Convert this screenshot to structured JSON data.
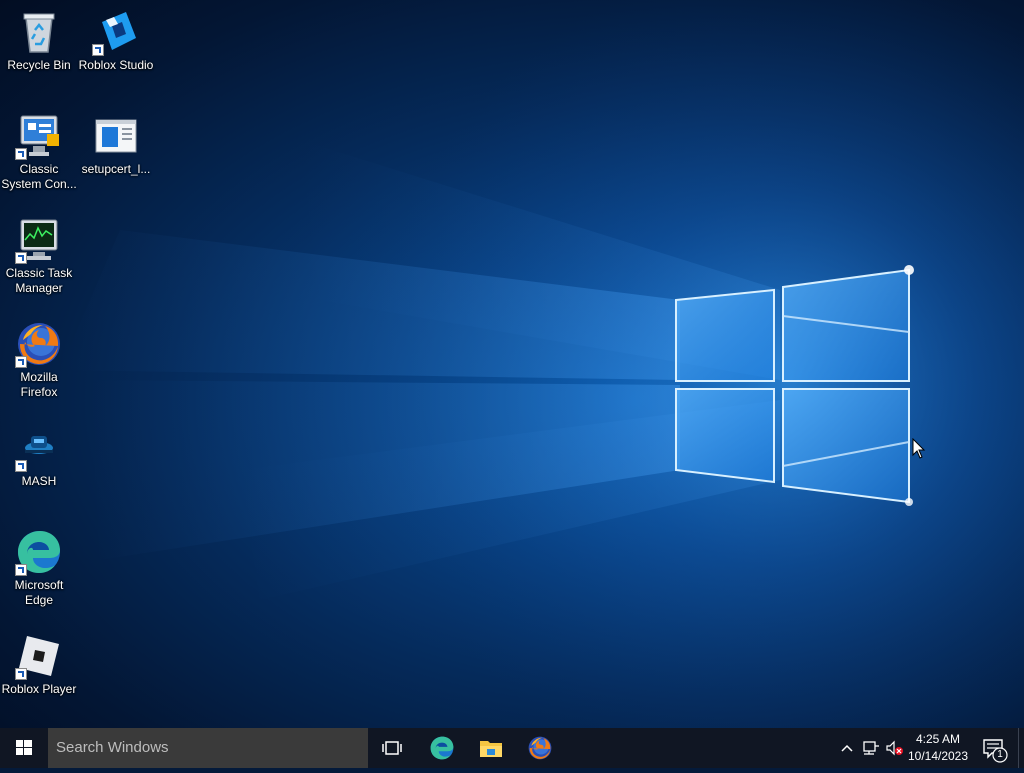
{
  "desktop": {
    "icons": [
      {
        "label": "Recycle Bin",
        "icon": "recycle-bin-icon"
      },
      {
        "label": "Roblox Studio",
        "icon": "roblox-studio-icon"
      },
      {
        "label": "Classic System Con...",
        "icon": "control-panel-icon"
      },
      {
        "label": "setupcert_l...",
        "icon": "window-file-icon"
      },
      {
        "label": "Classic Task Manager",
        "icon": "task-manager-icon"
      },
      {
        "label": "Mozilla Firefox",
        "icon": "firefox-icon"
      },
      {
        "label": "MASH",
        "icon": "mash-icon"
      },
      {
        "label": "Microsoft Edge",
        "icon": "edge-icon"
      },
      {
        "label": "Roblox Player",
        "icon": "roblox-player-icon"
      }
    ]
  },
  "taskbar": {
    "search_placeholder": "Search Windows",
    "pinned": [
      "task-view-icon",
      "edge-icon",
      "file-explorer-icon",
      "firefox-icon"
    ],
    "tray": [
      "chevron-up-icon",
      "network-icon",
      "volume-muted-icon"
    ],
    "clock": {
      "time": "4:25 AM",
      "date": "10/14/2023"
    },
    "notification_count": "1"
  },
  "colors": {
    "taskbar": "#101623",
    "search": "#3a3a3a",
    "accent": "#0078d7"
  }
}
